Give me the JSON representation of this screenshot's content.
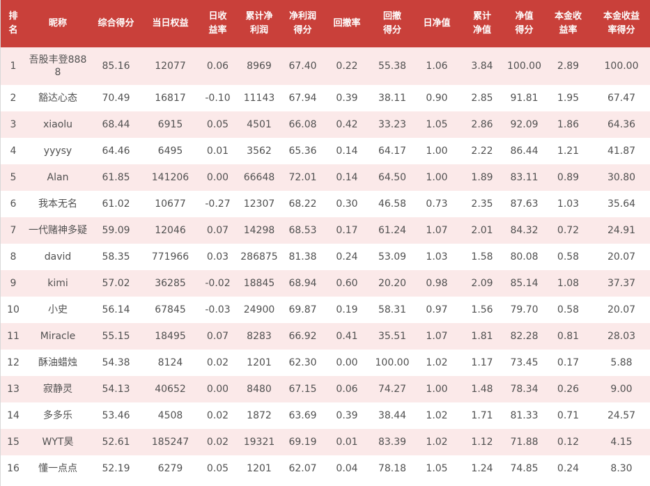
{
  "table": {
    "headers": [
      [
        "排",
        "名"
      ],
      [
        "昵称"
      ],
      [
        "综合得分"
      ],
      [
        "当日权益"
      ],
      [
        "日收",
        "益率"
      ],
      [
        "累计净",
        "利润"
      ],
      [
        "净利润",
        "得分"
      ],
      [
        "回撤率"
      ],
      [
        "回撤",
        "得分"
      ],
      [
        "日净值"
      ],
      [
        "累计",
        "净值"
      ],
      [
        "净值",
        "得分"
      ],
      [
        "本金收",
        "益率"
      ],
      [
        "本金收益",
        "率得分"
      ]
    ],
    "rows": [
      [
        "1",
        "吾股丰登8888",
        "85.16",
        "12077",
        "0.06",
        "8969",
        "67.40",
        "0.22",
        "55.38",
        "1.06",
        "3.84",
        "100.00",
        "2.89",
        "100.00"
      ],
      [
        "2",
        "豁达心态",
        "70.49",
        "16817",
        "-0.10",
        "11143",
        "67.94",
        "0.39",
        "38.11",
        "0.90",
        "2.85",
        "91.81",
        "1.95",
        "67.47"
      ],
      [
        "3",
        "xiaolu",
        "68.44",
        "6915",
        "0.05",
        "4501",
        "66.08",
        "0.42",
        "33.23",
        "1.05",
        "2.86",
        "92.09",
        "1.86",
        "64.36"
      ],
      [
        "4",
        "yyysy",
        "64.46",
        "6495",
        "0.01",
        "3562",
        "65.36",
        "0.14",
        "64.17",
        "1.00",
        "2.22",
        "86.44",
        "1.21",
        "41.87"
      ],
      [
        "5",
        "Alan",
        "61.85",
        "141206",
        "0.00",
        "66648",
        "72.01",
        "0.14",
        "64.50",
        "1.00",
        "1.89",
        "83.11",
        "0.89",
        "30.80"
      ],
      [
        "6",
        "我本无名",
        "61.02",
        "10677",
        "-0.27",
        "12307",
        "68.22",
        "0.30",
        "46.58",
        "0.73",
        "2.35",
        "87.63",
        "1.03",
        "35.64"
      ],
      [
        "7",
        "一代赌神多疑",
        "59.09",
        "12046",
        "0.07",
        "14298",
        "68.53",
        "0.17",
        "61.24",
        "1.07",
        "2.01",
        "84.32",
        "0.72",
        "24.91"
      ],
      [
        "8",
        "david",
        "58.35",
        "771966",
        "0.03",
        "286875",
        "81.38",
        "0.24",
        "53.09",
        "1.03",
        "1.58",
        "80.08",
        "0.58",
        "20.07"
      ],
      [
        "9",
        "kimi",
        "57.02",
        "36285",
        "-0.02",
        "18845",
        "68.94",
        "0.60",
        "20.20",
        "0.98",
        "2.09",
        "85.14",
        "1.08",
        "37.37"
      ],
      [
        "10",
        "小史",
        "56.14",
        "67845",
        "-0.03",
        "24900",
        "69.87",
        "0.19",
        "58.31",
        "0.97",
        "1.56",
        "79.70",
        "0.58",
        "20.07"
      ],
      [
        "11",
        "Miracle",
        "55.15",
        "18495",
        "0.07",
        "8283",
        "66.92",
        "0.41",
        "35.51",
        "1.07",
        "1.81",
        "82.28",
        "0.81",
        "28.03"
      ],
      [
        "12",
        "酥油蜡烛",
        "54.38",
        "8124",
        "0.02",
        "1201",
        "62.30",
        "0.00",
        "100.00",
        "1.02",
        "1.17",
        "73.45",
        "0.17",
        "5.88"
      ],
      [
        "13",
        "寂静灵",
        "54.13",
        "40652",
        "0.00",
        "8480",
        "67.15",
        "0.06",
        "74.27",
        "1.00",
        "1.48",
        "78.34",
        "0.26",
        "9.00"
      ],
      [
        "14",
        "多多乐",
        "53.46",
        "4508",
        "0.02",
        "1872",
        "63.69",
        "0.39",
        "38.44",
        "1.02",
        "1.71",
        "81.33",
        "0.71",
        "24.57"
      ],
      [
        "15",
        "WYT昊",
        "52.61",
        "185247",
        "0.02",
        "19321",
        "69.19",
        "0.01",
        "83.39",
        "1.02",
        "1.12",
        "71.88",
        "0.12",
        "4.15"
      ],
      [
        "16",
        "懂一点点",
        "52.19",
        "6279",
        "0.05",
        "1201",
        "62.07",
        "0.04",
        "78.18",
        "1.05",
        "1.24",
        "74.85",
        "0.24",
        "8.30"
      ]
    ]
  }
}
